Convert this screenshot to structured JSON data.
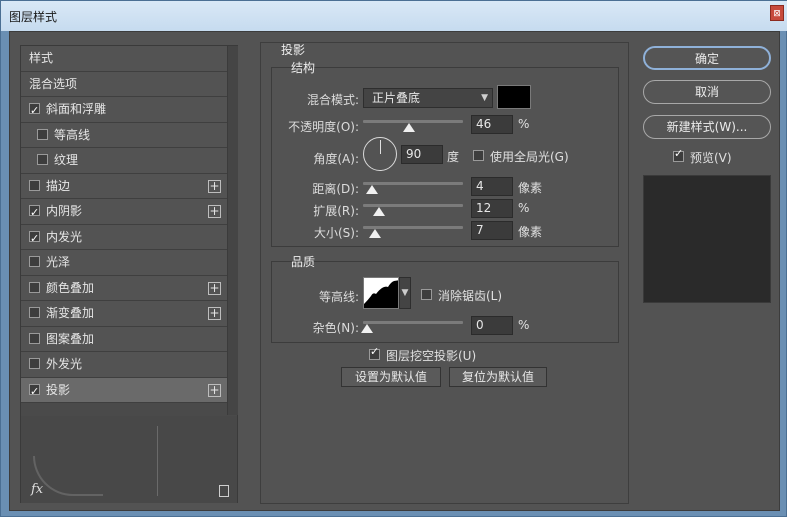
{
  "window": {
    "title": "图层样式",
    "close_glyph": "⊠"
  },
  "left": {
    "items": [
      {
        "label": "样式",
        "checkbox": false,
        "checked": false,
        "plus": false,
        "sub": false
      },
      {
        "label": "混合选项",
        "checkbox": false,
        "checked": false,
        "plus": false,
        "sub": false
      },
      {
        "label": "斜面和浮雕",
        "checkbox": true,
        "checked": true,
        "plus": false,
        "sub": false
      },
      {
        "label": "等高线",
        "checkbox": true,
        "checked": false,
        "plus": false,
        "sub": true
      },
      {
        "label": "纹理",
        "checkbox": true,
        "checked": false,
        "plus": false,
        "sub": true
      },
      {
        "label": "描边",
        "checkbox": true,
        "checked": false,
        "plus": true,
        "sub": false
      },
      {
        "label": "内阴影",
        "checkbox": true,
        "checked": true,
        "plus": true,
        "sub": false
      },
      {
        "label": "内发光",
        "checkbox": true,
        "checked": true,
        "plus": false,
        "sub": false
      },
      {
        "label": "光泽",
        "checkbox": true,
        "checked": false,
        "plus": false,
        "sub": false
      },
      {
        "label": "颜色叠加",
        "checkbox": true,
        "checked": false,
        "plus": true,
        "sub": false
      },
      {
        "label": "渐变叠加",
        "checkbox": true,
        "checked": false,
        "plus": true,
        "sub": false
      },
      {
        "label": "图案叠加",
        "checkbox": true,
        "checked": false,
        "plus": false,
        "sub": false
      },
      {
        "label": "外发光",
        "checkbox": true,
        "checked": false,
        "plus": false,
        "sub": false
      },
      {
        "label": "投影",
        "checkbox": true,
        "checked": true,
        "plus": true,
        "sub": false,
        "selected": true
      }
    ],
    "fx_label": "fx"
  },
  "panel": {
    "title": "投影",
    "structure": {
      "title": "结构",
      "blend_mode_label": "混合模式:",
      "blend_mode_value": "正片叠底",
      "shadow_color": "#000000",
      "opacity_label": "不透明度(O):",
      "opacity_value": "46",
      "opacity_unit": "%",
      "opacity_fraction": 0.46,
      "angle_label": "角度(A):",
      "angle_value": "90",
      "angle_unit": "度",
      "global_light_label": "使用全局光(G)",
      "distance_label": "距离(D):",
      "distance_value": "4",
      "distance_unit": "像素",
      "spread_label": "扩展(R):",
      "spread_value": "12",
      "spread_unit": "%",
      "size_label": "大小(S):",
      "size_value": "7",
      "size_unit": "像素"
    },
    "quality": {
      "title": "品质",
      "contour_label": "等高线:",
      "anti_alias_label": "消除锯齿(L)",
      "noise_label": "杂色(N):",
      "noise_value": "0",
      "noise_unit": "%"
    },
    "knockout_label": "图层挖空投影(U)",
    "make_default_label": "设置为默认值",
    "reset_default_label": "复位为默认值"
  },
  "right": {
    "ok_label": "确定",
    "cancel_label": "取消",
    "new_style_label": "新建样式(W)...",
    "preview_label": "预览(V)"
  }
}
